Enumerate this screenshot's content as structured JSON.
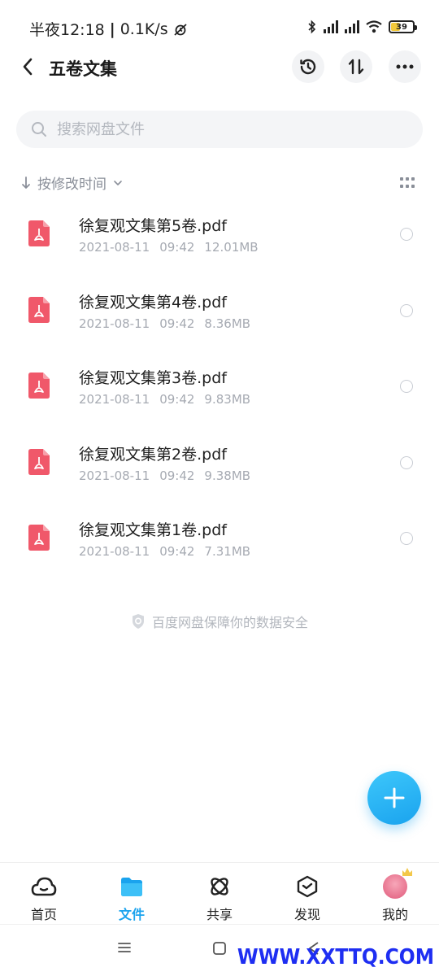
{
  "status_bar": {
    "time": "半夜12:18",
    "speed": "0.1K/s",
    "battery": "39"
  },
  "header": {
    "title": "五卷文集"
  },
  "search": {
    "placeholder": "搜索网盘文件"
  },
  "sort": {
    "label": "按修改时间"
  },
  "files": [
    {
      "name": "徐复观文集第5卷.pdf",
      "date": "2021-08-11",
      "time": "09:42",
      "size": "12.01MB"
    },
    {
      "name": "徐复观文集第4卷.pdf",
      "date": "2021-08-11",
      "time": "09:42",
      "size": "8.36MB"
    },
    {
      "name": "徐复观文集第3卷.pdf",
      "date": "2021-08-11",
      "time": "09:42",
      "size": "9.83MB"
    },
    {
      "name": "徐复观文集第2卷.pdf",
      "date": "2021-08-11",
      "time": "09:42",
      "size": "9.38MB"
    },
    {
      "name": "徐复观文集第1卷.pdf",
      "date": "2021-08-11",
      "time": "09:42",
      "size": "7.31MB"
    }
  ],
  "safe_note": "百度网盘保障你的数据安全",
  "bottom_nav": [
    {
      "label": "首页",
      "icon": "cloud-home-icon"
    },
    {
      "label": "文件",
      "icon": "folder-icon"
    },
    {
      "label": "共享",
      "icon": "share-orbit-icon"
    },
    {
      "label": "发现",
      "icon": "discover-box-icon"
    },
    {
      "label": "我的",
      "icon": "avatar"
    }
  ],
  "watermark": "WWW.XXTTQ.COM",
  "colors": {
    "accent": "#1aa3ee",
    "pdf_red": "#f0586a",
    "muted": "#a6aab2"
  }
}
